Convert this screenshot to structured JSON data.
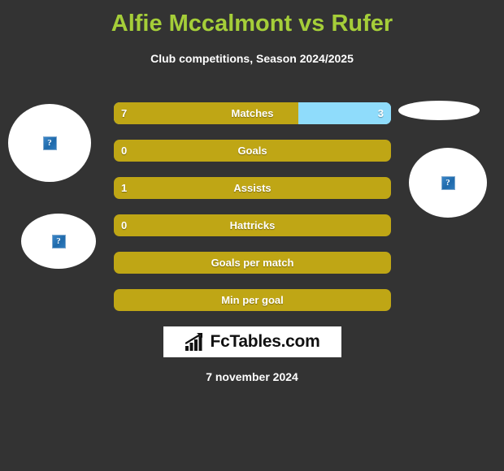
{
  "header": {
    "title": "Alfie Mccalmont vs Rufer",
    "subtitle": "Club competitions, Season 2024/2025",
    "title_color": "#a5ce39"
  },
  "photos": {
    "home_top_icon": "broken-image-icon",
    "home_bottom_icon": "broken-image-icon",
    "away_top_icon": "broken-image-icon",
    "away_bottom_icon": "broken-image-icon",
    "placeholder_glyph": "?"
  },
  "footer": {
    "logo_text": "FcTables.com",
    "logo_icon": "bar-chart-growth-icon",
    "date": "7 november 2024"
  },
  "chart_data": {
    "type": "bar",
    "title": "Alfie Mccalmont vs Rufer",
    "subtitle": "Club competitions, Season 2024/2025",
    "orientation": "horizontal-stacked",
    "legend": [
      "Alfie Mccalmont",
      "Rufer"
    ],
    "colors": {
      "home": "#bfa615",
      "away": "#8fdcfb",
      "background": "#333333",
      "text": "#ffffff"
    },
    "categories": [
      "Matches",
      "Goals",
      "Assists",
      "Hattricks",
      "Goals per match",
      "Min per goal"
    ],
    "series": [
      {
        "name": "Alfie Mccalmont",
        "values": [
          "7",
          "0",
          "1",
          "0",
          "",
          ""
        ]
      },
      {
        "name": "Rufer",
        "values": [
          "3",
          "",
          "",
          "",
          "",
          ""
        ]
      }
    ],
    "rows": [
      {
        "label": "Matches",
        "home_value": "7",
        "away_value": "3",
        "home_pct": 66.5
      },
      {
        "label": "Goals",
        "home_value": "0",
        "away_value": "",
        "home_pct": 100
      },
      {
        "label": "Assists",
        "home_value": "1",
        "away_value": "",
        "home_pct": 100
      },
      {
        "label": "Hattricks",
        "home_value": "0",
        "away_value": "",
        "home_pct": 100
      },
      {
        "label": "Goals per match",
        "home_value": "",
        "away_value": "",
        "home_pct": 100
      },
      {
        "label": "Min per goal",
        "home_value": "",
        "away_value": "",
        "home_pct": 100
      }
    ]
  }
}
